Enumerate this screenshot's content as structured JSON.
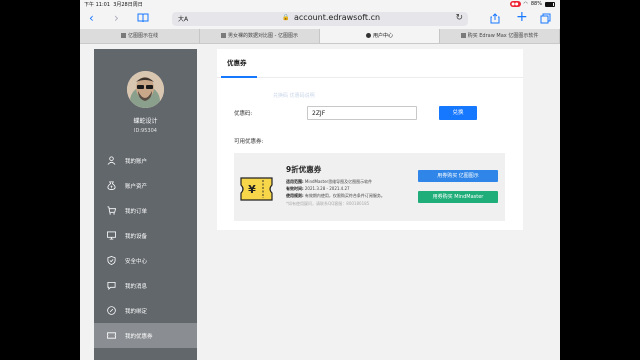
{
  "statusbar": {
    "time": "下午 11:01",
    "date": "3月28日周日",
    "battery": "88%",
    "rec": "●●"
  },
  "toolbar": {
    "text_size": "大A",
    "url": "account.edrawsoft.cn",
    "lock": "🔒"
  },
  "tabs": [
    {
      "label": "亿图图示在线"
    },
    {
      "label": "男女裸的数据对比图 - 亿图图示"
    },
    {
      "label": "用户中心"
    },
    {
      "label": "购买 Edraw Max 亿图图示软件"
    }
  ],
  "sidebar": {
    "username": "蝶蛇设计",
    "user_id": "ID:95304",
    "items": [
      {
        "label": "我的账户",
        "icon": "user-icon"
      },
      {
        "label": "账户资产",
        "icon": "wallet-icon"
      },
      {
        "label": "我的订单",
        "icon": "cart-icon"
      },
      {
        "label": "我的设备",
        "icon": "monitor-icon"
      },
      {
        "label": "安全中心",
        "icon": "shield-icon"
      },
      {
        "label": "我的消息",
        "icon": "message-icon"
      },
      {
        "label": "我的绑定",
        "icon": "link-icon"
      },
      {
        "label": "我的优惠券",
        "icon": "ticket-icon"
      }
    ],
    "active_index": 7
  },
  "main": {
    "title": "优惠券",
    "ghost_text": "兑换码   优惠码说明",
    "code_label": "优惠码:",
    "code_value": "2ZJF",
    "redeem_label": "兑换",
    "available_label": "可用优惠券:",
    "coupon": {
      "title": "9折优惠券",
      "scope_label": "适用范围:",
      "scope_value": "MindMaster思维导图及亿图图示软件",
      "valid_label": "有效时间:",
      "valid_value": "2021.3.28 - 2021.4.27",
      "rule_label": "使用规则:",
      "rule_value": "有效期内使用，仅限购买符合条件订阅服务。",
      "note": "*如有使用疑问，请联系QQ客服：800180185",
      "buy_edraw_label": "用券购买 亿图图示",
      "buy_mindmaster_label": "用券购买 MindMaster"
    }
  },
  "colors": {
    "accent": "#1677ff",
    "sidebar": "#62676c",
    "green": "#1fae7a"
  }
}
